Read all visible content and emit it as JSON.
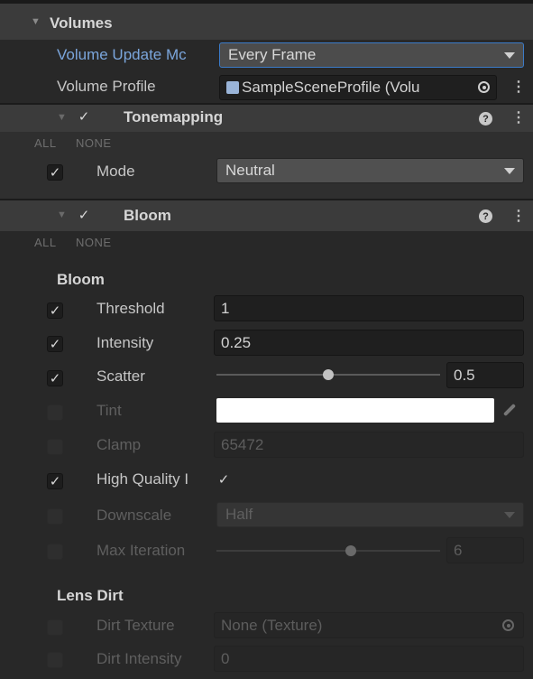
{
  "volumes": {
    "title": "Volumes",
    "update_mode_label": "Volume Update Mc",
    "update_mode_value": "Every Frame",
    "profile_label": "Volume Profile",
    "profile_value": "SampleSceneProfile (Volu"
  },
  "tonemapping": {
    "title": "Tonemapping",
    "all": "ALL",
    "none": "NONE",
    "mode_label": "Mode",
    "mode_value": "Neutral"
  },
  "bloom": {
    "title": "Bloom",
    "all": "ALL",
    "none": "NONE",
    "section_label": "Bloom",
    "threshold_label": "Threshold",
    "threshold_value": "1",
    "intensity_label": "Intensity",
    "intensity_value": "0.25",
    "scatter_label": "Scatter",
    "scatter_value": "0.5",
    "scatter_fraction": 0.5,
    "tint_label": "Tint",
    "tint_color": "#ffffff",
    "clamp_label": "Clamp",
    "clamp_value": "65472",
    "hq_label": "High Quality I",
    "downscale_label": "Downscale",
    "downscale_value": "Half",
    "max_iter_label": "Max Iteration",
    "max_iter_value": "6",
    "max_iter_fraction": 0.6
  },
  "lens_dirt": {
    "section_label": "Lens Dirt",
    "texture_label": "Dirt Texture",
    "texture_value": "None (Texture)",
    "intensity_label": "Dirt Intensity",
    "intensity_value": "0"
  },
  "icons": {
    "check": "✓",
    "kebab": "⋮",
    "help": "?",
    "foldout": "▼"
  },
  "colors": {
    "accent": "#3b7bc8",
    "label_blue": "#7ba6dc",
    "header_bg": "#3b3b3b"
  }
}
